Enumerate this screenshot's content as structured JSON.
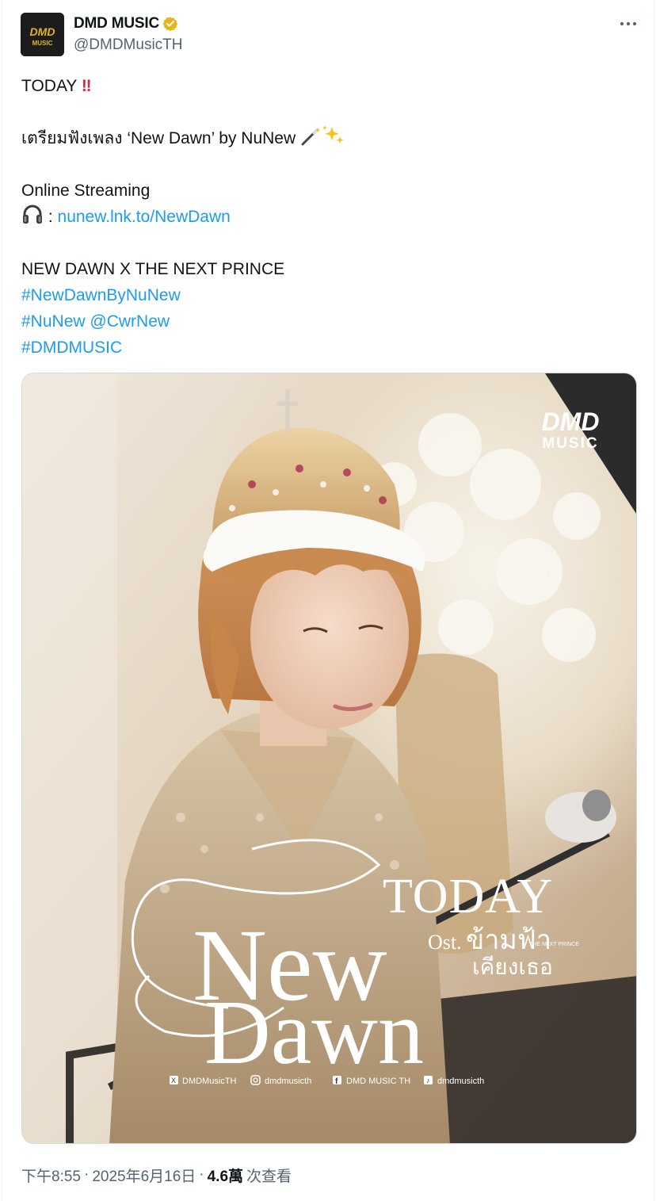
{
  "author": {
    "display_name": "DMD MUSIC",
    "handle": "@DMDMusicTH",
    "avatar_text_top": "DMD",
    "avatar_text_bottom": "MUSIC",
    "verified_color": "#e2b719"
  },
  "tweet": {
    "line1": "TODAY ",
    "line1_emoji": "‼️",
    "line2": "เตรียมฟังเพลง ‘New Dawn’ by NuNew ",
    "line2_emoji": "🪄✨",
    "line3": "Online Streaming",
    "line4_emoji": "🎧",
    "line4_sep": " : ",
    "link": "nunew.lnk.to/NewDawn",
    "line5": "NEW DAWN X THE NEXT PRINCE",
    "hashtag1": "#NewDawnByNuNew",
    "hashtag2": "#NuNew",
    "mention": "@CwrNew",
    "hashtag3": "#DMDMUSIC"
  },
  "media": {
    "logo_top": "DMD",
    "logo_bottom": "MUSIC",
    "headline": "TODAY",
    "title_line1": "New",
    "title_line2": "Dawn",
    "ost_prefix": "Ost.",
    "ost_title_line1": "ข้ามฟ้า",
    "ost_title_line2": "เคียงเธอ",
    "ost_small": "THE NEXT PRINCE",
    "socials": [
      {
        "icon": "x-icon",
        "label": "DMDMusicTH"
      },
      {
        "icon": "instagram-icon",
        "label": "dmdmusicth"
      },
      {
        "icon": "facebook-icon",
        "label": "DMD MUSIC TH"
      },
      {
        "icon": "tiktok-icon",
        "label": "dmdmusicth"
      }
    ]
  },
  "footer": {
    "time": "下午8:55",
    "dot": "·",
    "date": "2025年6月16日",
    "views_count": "4.6萬",
    "views_label": "次查看"
  },
  "colors": {
    "link": "#1d9bf0",
    "muted": "#536471",
    "text": "#0f1419"
  }
}
